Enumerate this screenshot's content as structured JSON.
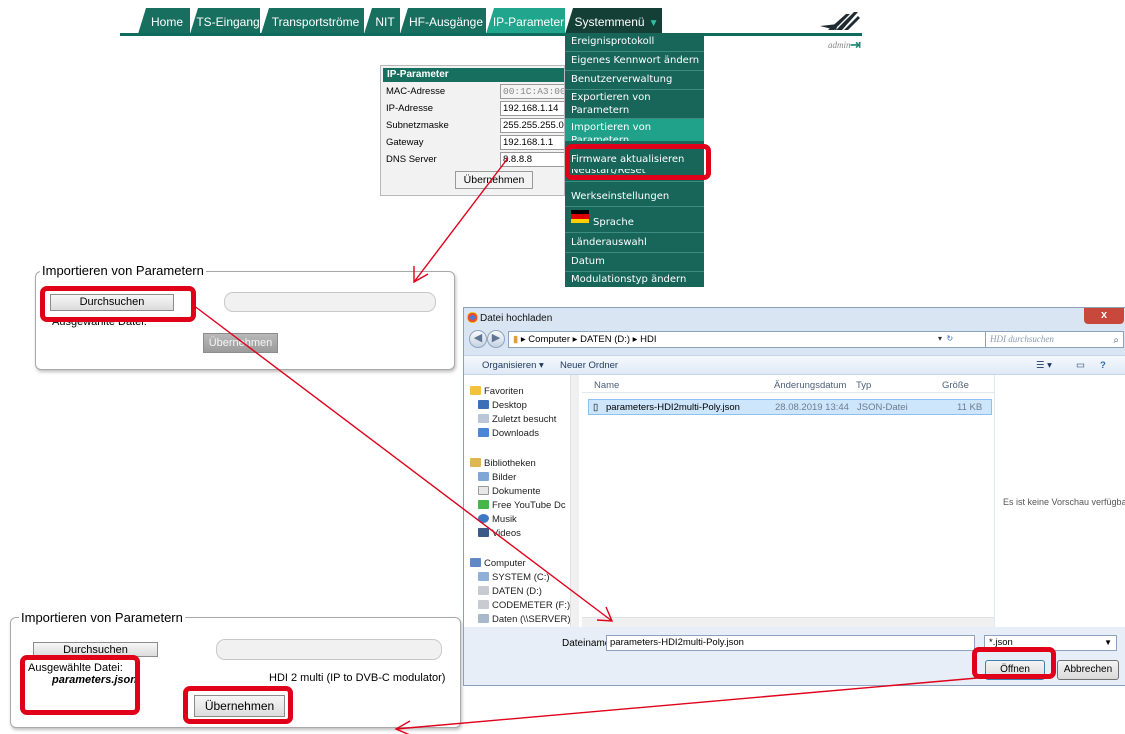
{
  "nav": {
    "tabs": [
      "Home",
      "TS-Eingang",
      "Transportströme",
      "NIT",
      "HF-Ausgänge",
      "IP-Parameter",
      "Systemmenü"
    ],
    "active_tab": "IP-Parameter",
    "user": "admin"
  },
  "system_menu": {
    "items": [
      "Ereignisprotokoll",
      "Eigenes Kennwort ändern",
      "Benutzerverwaltung",
      "Exportieren von Parametern",
      "Importieren von Parametern",
      "Firmware aktualisieren",
      "Neustart/Reset",
      "Werkseinstellungen",
      "Sprache",
      "Länderauswahl",
      "Datum",
      "Modulationstyp ändern"
    ],
    "highlighted": "Importieren von Parametern"
  },
  "ip_panel": {
    "title": "IP-Parameter",
    "rows": [
      {
        "label": "MAC-Adresse",
        "value": "00:1C:A3:00:60"
      },
      {
        "label": "IP-Adresse",
        "value": "192.168.1.14"
      },
      {
        "label": "Subnetzmaske",
        "value": "255.255.255.0"
      },
      {
        "label": "Gateway",
        "value": "192.168.1.1"
      },
      {
        "label": "DNS Server",
        "value": "8.8.8.8"
      }
    ],
    "apply_label": "Übernehmen"
  },
  "import_top": {
    "legend": "Importieren von Parametern",
    "browse_label": "Durchsuchen",
    "selected_label": "Ausgewählte Datei:",
    "apply_label": "Übernehmen"
  },
  "import_bottom": {
    "legend": "Importieren von Parametern",
    "browse_label": "Durchsuchen",
    "selected_label": "Ausgewählte Datei:",
    "selected_file": "parameters.json",
    "device_info": "HDI 2 multi (IP to DVB-C modulator)",
    "apply_label": "Übernehmen"
  },
  "dialog": {
    "title": "Datei hochladen",
    "address": [
      "Computer",
      "DATEN (D:)",
      "HDI"
    ],
    "search_placeholder": "HDI durchsuchen",
    "toolbar": {
      "organize": "Organisieren ▾",
      "new_folder": "Neuer Ordner"
    },
    "nav_favorites": [
      "Favoriten",
      "Desktop",
      "Zuletzt besucht",
      "Downloads"
    ],
    "nav_libraries": [
      "Bibliotheken",
      "Bilder",
      "Dokumente",
      "Free YouTube Dc",
      "Musik",
      "Videos"
    ],
    "nav_computer": [
      "Computer",
      "SYSTEM (C:)",
      "DATEN (D:)",
      "CODEMETER (F:)",
      "Daten (\\\\SERVER)"
    ],
    "columns": [
      "Name",
      "Änderungsdatum",
      "Typ",
      "Größe"
    ],
    "files": [
      {
        "name": "parameters-HDI2multi-Poly.json",
        "date": "28.08.2019 13:44",
        "type": "JSON-Datei",
        "size": "11 KB"
      }
    ],
    "preview_text": "Es ist keine Vorschau verfügbar.",
    "filename_label": "Dateiname:",
    "filename_value": "parameters-HDI2multi-Poly.json",
    "filter_value": "*.json",
    "open_label": "Öffnen",
    "cancel_label": "Abbrechen",
    "close_label": "x"
  },
  "colors": {
    "nav_dark": "#176f5f",
    "nav_active": "#21a58c",
    "menu_bg": "#18655a",
    "annotation_red": "#e0001a"
  }
}
